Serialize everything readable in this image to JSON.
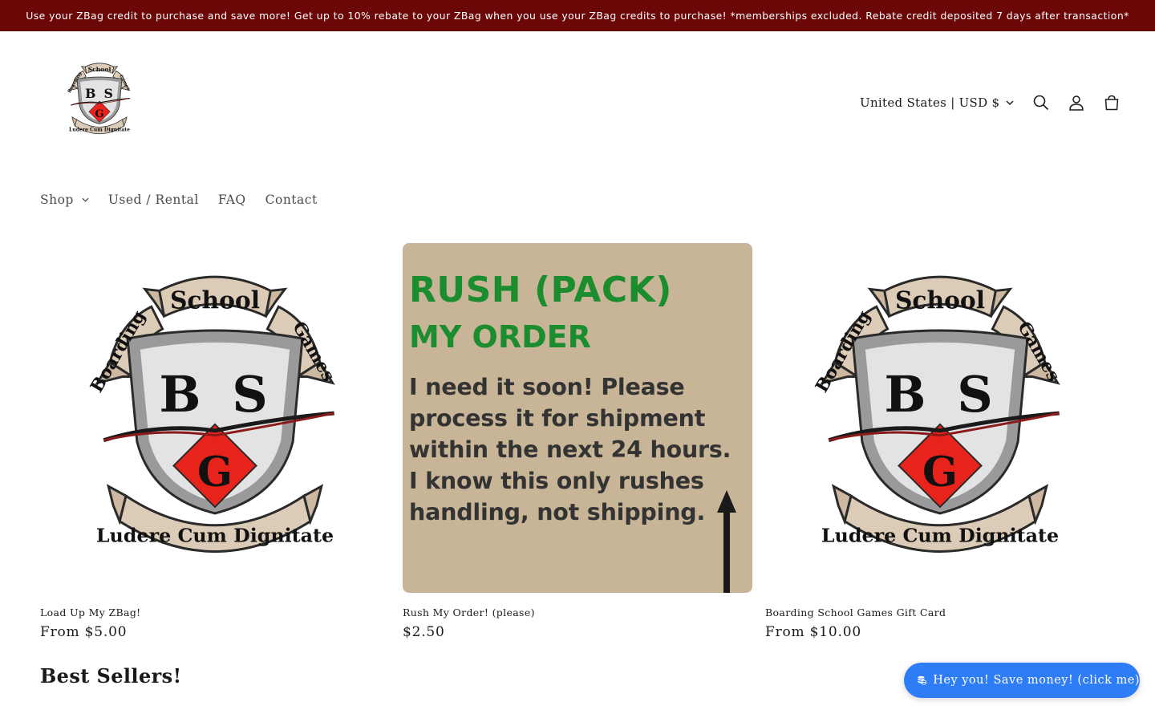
{
  "announcement": {
    "text": "Use your ZBag credit to purchase and save more! Get up to 10% rebate to your ZBag when you use your ZBag credits to purchase! *memberships excluded. Rebate credit deposited 7 days after transaction*"
  },
  "logo": {
    "top_banner": "School",
    "left_banner": "Boarding",
    "right_banner": "Games",
    "motto": "Ludere Cum Dignitate",
    "letters": [
      "B",
      "S",
      "G"
    ]
  },
  "header": {
    "country_selector": "United States | USD $",
    "icons": [
      "search-icon",
      "account-icon",
      "cart-icon"
    ]
  },
  "nav": {
    "items": [
      {
        "label": "Shop",
        "has_dropdown": true
      },
      {
        "label": "Used / Rental",
        "has_dropdown": false
      },
      {
        "label": "FAQ",
        "has_dropdown": false
      },
      {
        "label": "Contact",
        "has_dropdown": false
      }
    ]
  },
  "products": [
    {
      "title": "Load Up My ZBag!",
      "price": "From $5.00",
      "image": "boarding-school-games-crest"
    },
    {
      "title": "Rush My Order! (please)",
      "price": "$2.50",
      "image": "rush-pack-my-order-card"
    },
    {
      "title": "Boarding School Games Gift Card",
      "price": "From $10.00",
      "image": "boarding-school-games-crest"
    }
  ],
  "rush_image": {
    "heading": "RUSH (PACK)",
    "subheading": "MY ORDER",
    "body": [
      "I need it soon! Please",
      "process it for shipment",
      "within the next 24 hours.",
      "I know this only rushes",
      "handling, not shipping."
    ]
  },
  "section": {
    "title": "Best Sellers!"
  },
  "chat": {
    "label": "Hey you! Save money! (click me)",
    "icon": "coins-icon"
  },
  "colors": {
    "announcement_bg": "#6b0706",
    "chat_bg": "#2f7df6",
    "rush_green": "#1b8d2e",
    "crest_red": "#e8231b",
    "banner_tan": "#dccbb6"
  }
}
